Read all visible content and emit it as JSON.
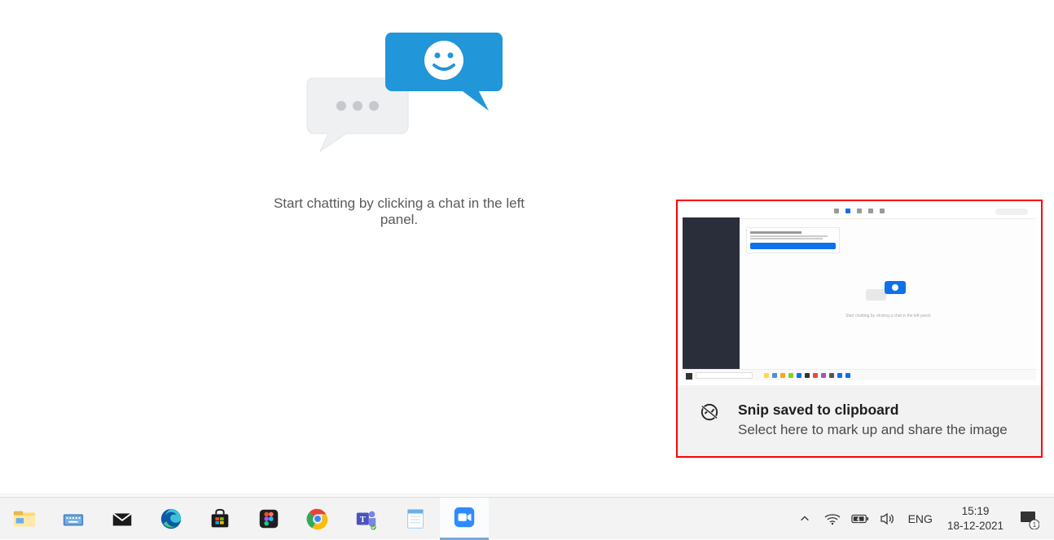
{
  "emptyState": {
    "message": "Start chatting by clicking a chat in the left panel."
  },
  "notification": {
    "title": "Snip saved to clipboard",
    "subtitle": "Select here to mark up and share the image"
  },
  "taskbar": {
    "apps": [
      {
        "name": "file-explorer"
      },
      {
        "name": "on-screen-keyboard"
      },
      {
        "name": "mail"
      },
      {
        "name": "edge"
      },
      {
        "name": "microsoft-store"
      },
      {
        "name": "figma"
      },
      {
        "name": "chrome"
      },
      {
        "name": "teams"
      },
      {
        "name": "notepad"
      },
      {
        "name": "zoom"
      }
    ]
  },
  "systemTray": {
    "lang": "ENG",
    "time": "15:19",
    "date": "18-12-2021",
    "notificationCount": "1"
  }
}
